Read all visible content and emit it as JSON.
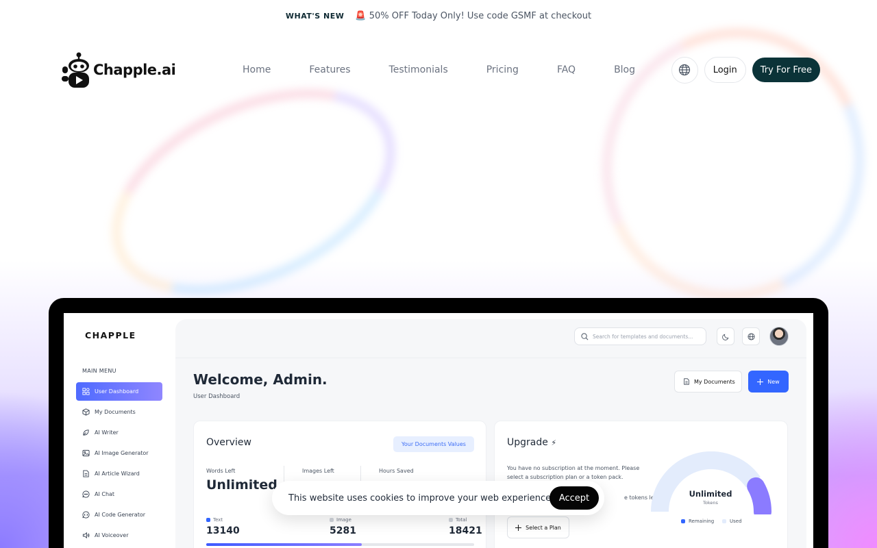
{
  "announcement": {
    "tag": "WHAT'S NEW",
    "message": "🚨 50% OFF Today Only! Use code GSMF at checkout"
  },
  "header": {
    "logo_text": "Chapple.ai",
    "nav": [
      "Home",
      "Features",
      "Testimonials",
      "Pricing",
      "FAQ",
      "Blog"
    ],
    "language_icon": "globe-icon",
    "login_label": "Login",
    "cta_label": "Try For Free"
  },
  "dashboard": {
    "brand": "CHAPPLE",
    "menu_title": "MAIN MENU",
    "menu": [
      {
        "label": "User Dashboard",
        "icon": "grid-icon"
      },
      {
        "label": "My Documents",
        "icon": "box-icon"
      },
      {
        "label": "AI Writer",
        "icon": "pen-icon"
      },
      {
        "label": "AI Image Generator",
        "icon": "image-icon"
      },
      {
        "label": "AI Article Wizard",
        "icon": "document-icon"
      },
      {
        "label": "AI Chat",
        "icon": "chat-icon"
      },
      {
        "label": "AI Code Generator",
        "icon": "code-icon"
      },
      {
        "label": "AI Voiceover",
        "icon": "speaker-icon"
      }
    ],
    "search_placeholder": "Search for templates and documents...",
    "welcome_title": "Welcome, Admin.",
    "welcome_subtitle": "User Dashboard",
    "my_documents_label": "My Documents",
    "new_label": "New",
    "overview": {
      "title": "Overview",
      "values_label": "Your Documents Values",
      "words_left_label": "Words Left",
      "words_left_value": "Unlimited",
      "images_left_label": "Images Left",
      "hours_saved_label": "Hours Saved",
      "legend": {
        "text": "Text",
        "image": "Image",
        "total": "Total"
      },
      "text_count": "13140",
      "image_count": "5281",
      "total_count": "18421",
      "text_share": 0.58,
      "colors": {
        "text": "#3366ff",
        "image": "#d1d5db",
        "total": "#d1d5db"
      }
    },
    "upgrade": {
      "title": "Upgrade",
      "bolt_icon": "⚡",
      "message": "You have no subscription at the moment. Please select a subscription plan or a token pack.",
      "tokens_text": "e tokens left.",
      "select_plan_label": "Select a Plan",
      "gauge_label": "Unlimited",
      "gauge_sub": "Tokens",
      "remaining_label": "Remaining",
      "used_label": "Used",
      "remaining_share": 0.82,
      "colors": {
        "remaining": "#e3ecfc",
        "used": "#8b7bff"
      }
    }
  },
  "cookie": {
    "text": "This website uses cookies to improve your web experience.",
    "accept_label": "Accept"
  }
}
